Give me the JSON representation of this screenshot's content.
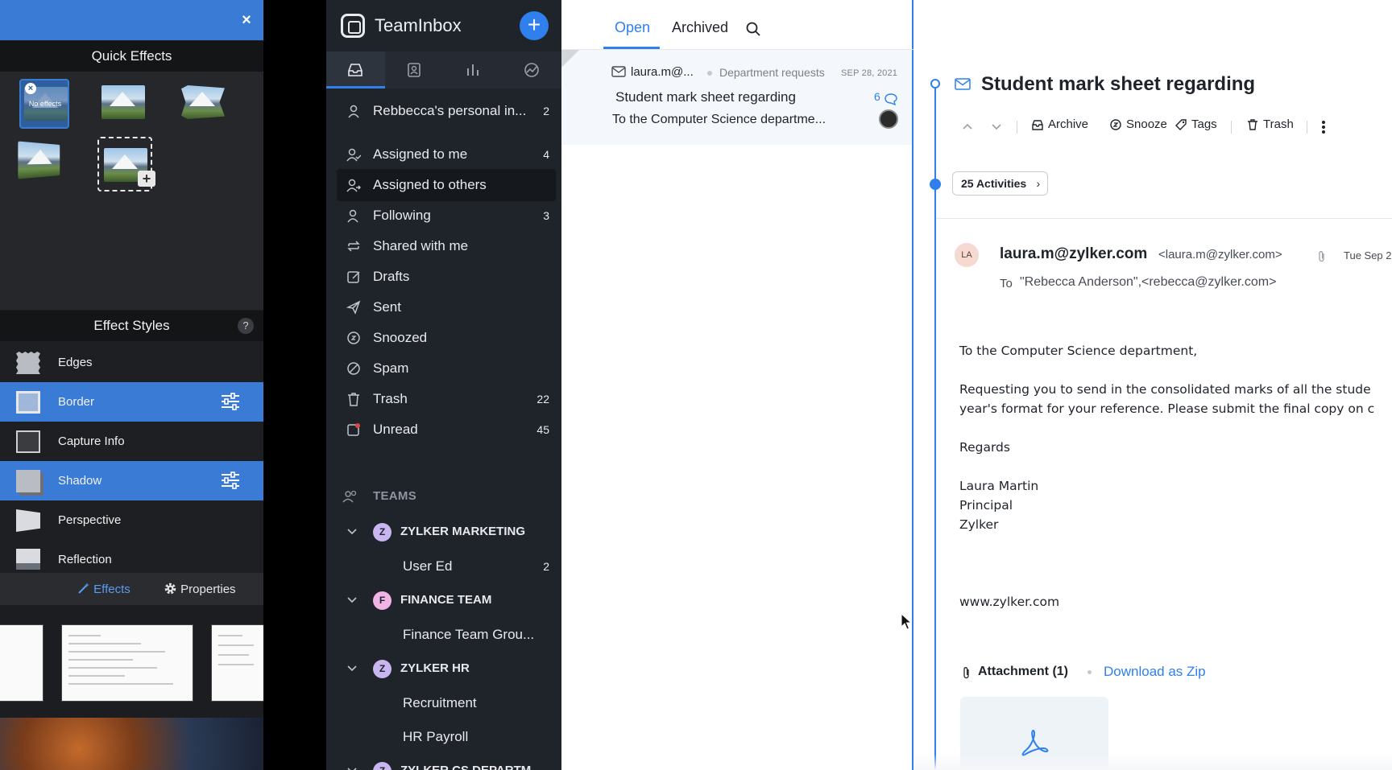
{
  "effects_panel": {
    "close_glyph": "×",
    "quick_effects_title": "Quick Effects",
    "no_effects_label": "No effects",
    "effect_styles_title": "Effect Styles",
    "help_glyph": "?",
    "styles": [
      {
        "label": "Edges",
        "icon": "edges-icon",
        "active": false
      },
      {
        "label": "Border",
        "icon": "border-icon",
        "active": true
      },
      {
        "label": "Capture Info",
        "icon": "capture-info-icon",
        "active": false
      },
      {
        "label": "Shadow",
        "icon": "shadow-icon",
        "active": true
      },
      {
        "label": "Perspective",
        "icon": "perspective-icon",
        "active": false
      },
      {
        "label": "Reflection",
        "icon": "reflection-icon",
        "active": false
      }
    ],
    "tabs": {
      "effects": "Effects",
      "properties": "Properties"
    },
    "accent": "#3a7bd5"
  },
  "teaminbox": {
    "app_name": "TeamInbox",
    "compose_glyph": "+",
    "nav": [
      {
        "label": "Rebbecca's personal in...",
        "count": "2",
        "icon": "person-icon"
      },
      {
        "label": "Assigned to me",
        "count": "4",
        "icon": "assigned-icon"
      },
      {
        "label": "Assigned to others",
        "count": "",
        "icon": "assigned-others-icon"
      },
      {
        "label": "Following",
        "count": "3",
        "icon": "following-icon"
      },
      {
        "label": "Shared with me",
        "count": "",
        "icon": "shared-icon"
      },
      {
        "label": "Drafts",
        "count": "",
        "icon": "drafts-icon"
      },
      {
        "label": "Sent",
        "count": "",
        "icon": "sent-icon"
      },
      {
        "label": "Snoozed",
        "count": "",
        "icon": "snooze-icon"
      },
      {
        "label": "Spam",
        "count": "",
        "icon": "spam-icon"
      },
      {
        "label": "Trash",
        "count": "22",
        "icon": "trash-icon"
      },
      {
        "label": "Unread",
        "count": "45",
        "icon": "unread-icon"
      }
    ],
    "teams_heading": "TEAMS",
    "teams": [
      {
        "initial": "Z",
        "name": "ZYLKER MARKETING",
        "color": "#c9b5f0",
        "subs": [
          {
            "label": "User Ed",
            "count": "2"
          }
        ]
      },
      {
        "initial": "F",
        "name": "FINANCE TEAM",
        "color": "#f0b5e6",
        "subs": [
          {
            "label": "Finance Team Grou...",
            "count": ""
          }
        ]
      },
      {
        "initial": "Z",
        "name": "ZYLKER HR",
        "color": "#c9b5f0",
        "subs": [
          {
            "label": "Recruitment",
            "count": ""
          },
          {
            "label": "HR Payroll",
            "count": ""
          }
        ]
      },
      {
        "initial": "Z",
        "name": "ZYLKER CS DEPARTM...",
        "color": "#c9b5f0",
        "subs": []
      }
    ],
    "accent": "#2f80ed"
  },
  "list": {
    "tabs": {
      "open": "Open",
      "archived": "Archived"
    },
    "item": {
      "from": "laura.m@...",
      "department": "Department requests",
      "date": "SEP 28, 2021",
      "subject": "Student mark sheet regarding",
      "comment_count": "6",
      "preview": "To the Computer Science departme..."
    }
  },
  "detail": {
    "subject": "Student mark sheet regarding",
    "toolbar": {
      "archive": "Archive",
      "snooze": "Snooze",
      "tags": "Tags",
      "trash": "Trash"
    },
    "activities": "25 Activities",
    "sender_initials": "LA",
    "sender": "laura.m@zylker.com",
    "sender_address": "<laura.m@zylker.com>",
    "time": "Tue Sep 2",
    "to_label": "To",
    "to": "\"Rebecca Anderson\",<rebecca@zylker.com>",
    "body": {
      "greeting": "To the Computer Science department,",
      "line1": "Requesting you to send in the consolidated marks of all the stude",
      "line2": "year's format for your reference. Please submit the final copy on c",
      "regards": "Regards",
      "sig_name": "Laura Martin",
      "sig_title": "Principal",
      "sig_company": "Zylker",
      "website": "www.zylker.com"
    },
    "attachment_label": "Attachment (1)",
    "download_zip": "Download as Zip"
  }
}
